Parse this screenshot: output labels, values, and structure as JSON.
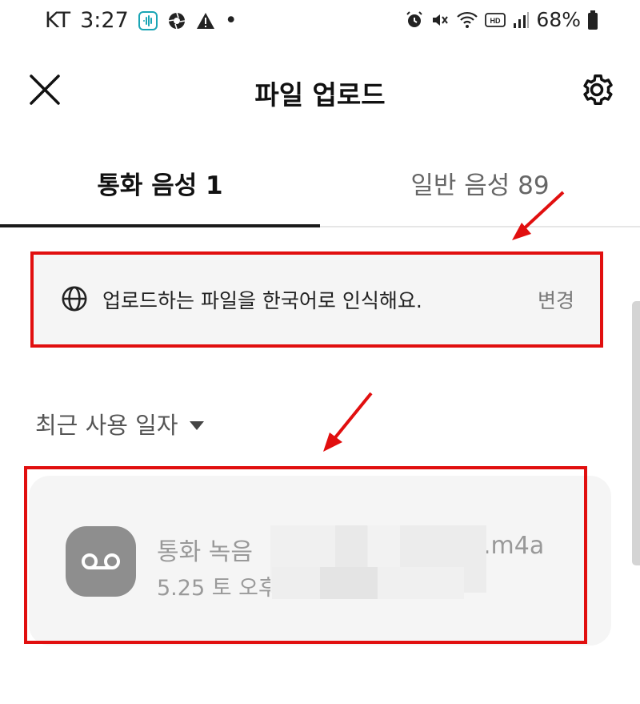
{
  "status_bar": {
    "carrier": "KT",
    "time": "3:27",
    "dot": "•",
    "battery": "68%",
    "icons": [
      "voice-recorder-icon",
      "aperture-icon",
      "warning-icon",
      "alarm-icon",
      "mute-icon",
      "wifi-icon",
      "hd-icon",
      "signal-icon",
      "battery-icon"
    ]
  },
  "header": {
    "title": "파일 업로드",
    "close_icon": "close-icon",
    "settings_icon": "gear-icon"
  },
  "tabs": [
    {
      "label": "통화 음성 1",
      "active": true
    },
    {
      "label": "일반 음성 89",
      "active": false
    }
  ],
  "language_notice": {
    "icon": "globe-icon",
    "text": "업로드하는 파일을 한국어로 인식해요.",
    "action": "변경"
  },
  "sort": {
    "label": "최근 사용 일자",
    "icon": "caret-down-icon"
  },
  "files": [
    {
      "icon": "voicemail-icon",
      "name": "통화 녹음",
      "extension": ".m4a",
      "meta": "5.25 토 오후"
    }
  ],
  "colors": {
    "annotation_red": "#e10f0f",
    "card_bg": "#f5f5f5",
    "file_icon_bg": "#8e8e8e"
  }
}
